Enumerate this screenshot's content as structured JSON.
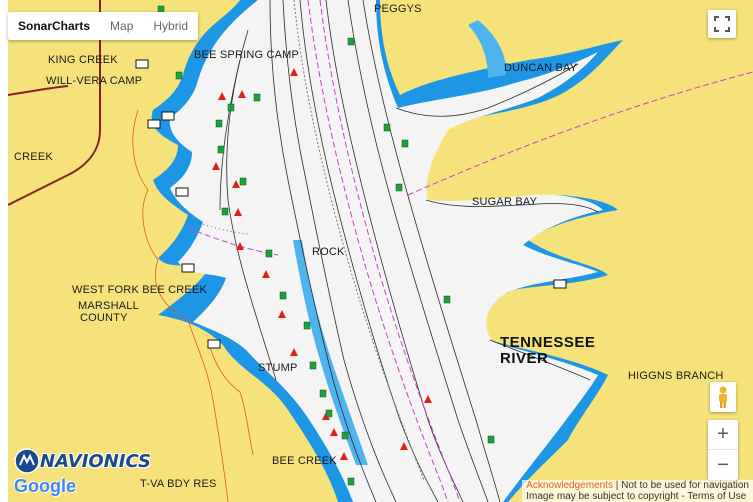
{
  "map_type_control": {
    "options": [
      {
        "label": "SonarCharts",
        "active": true
      },
      {
        "label": "Map",
        "active": false
      },
      {
        "label": "Hybrid",
        "active": false
      }
    ]
  },
  "controls": {
    "fullscreen_icon": "fullscreen-icon",
    "pegman_icon": "pegman-icon",
    "zoom_in": "+",
    "zoom_out": "−"
  },
  "place_labels": {
    "peggys": "PEGGYS",
    "king_creek": "KING CREEK",
    "will_vera_camp": "WILL-VERA CAMP",
    "bee_spring_camp": "BEE SPRING CAMP",
    "duncan_bay": "DUNCAN BAY",
    "creek": "CREEK",
    "sugar_bay": "SUGAR BAY",
    "rock": "ROCK",
    "west_fork_bee_creek": "WEST FORK BEE CREEK",
    "marshall": "MARSHALL",
    "county": "COUNTY",
    "tennessee": "TENNESSEE",
    "river": "RIVER",
    "stump": "STUMP",
    "higgins_branch": "HIGGNS BRANCH",
    "bee_creek": "BEE CREEK",
    "tva_bdy_res": "T-VA BDY RES"
  },
  "branding": {
    "navionics": "NAVIONICS",
    "google": "Google"
  },
  "attribution": {
    "acknowledgements": "Acknowledgements",
    "navigation_note": "| Not to be used for navigation",
    "copyright_note": "Image may be subject to copyright - Terms of Use"
  },
  "colors": {
    "land": "#f5e27a",
    "water_deep": "#f4f4f4",
    "water_shallow": "#1e96e6",
    "contour": "#2a2a2a",
    "channel_magenta": "#d23cc8",
    "road": "#8a1f2a",
    "buoy_red": "#e0201a",
    "buoy_green": "#1ea03c"
  }
}
